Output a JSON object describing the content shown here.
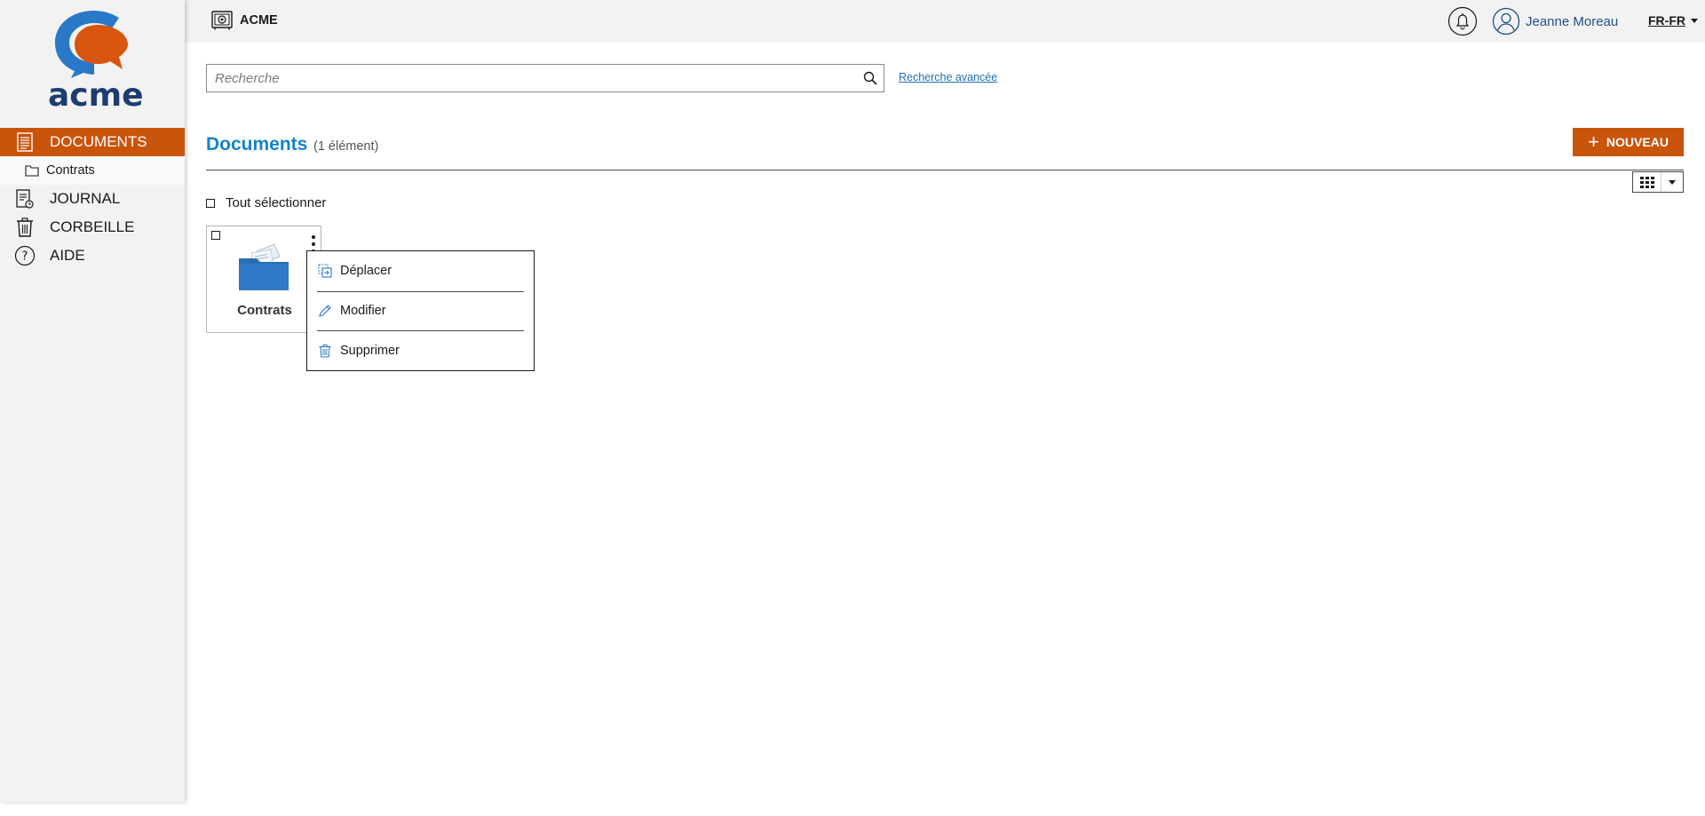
{
  "app": {
    "logo_text": "acme",
    "brand": "ACME"
  },
  "colors": {
    "accent": "#c9540c",
    "title_blue": "#1683c5",
    "logo_blue": "#2a78c8",
    "logo_orange": "#d9550e",
    "folder_blue": "#2a6db5"
  },
  "sidebar": {
    "items": [
      {
        "label": "DOCUMENTS",
        "icon": "document-list-icon",
        "active": true
      },
      {
        "label": "Contrats",
        "icon": "folder-icon",
        "sub": true
      },
      {
        "label": "JOURNAL",
        "icon": "journal-icon"
      },
      {
        "label": "CORBEILLE",
        "icon": "trash-icon"
      },
      {
        "label": "AIDE",
        "icon": "help-icon"
      }
    ]
  },
  "header": {
    "user_name": "Jeanne Moreau",
    "language": "FR-FR",
    "notifications_icon": "bell-icon",
    "user_icon": "user-icon"
  },
  "search": {
    "placeholder": "Recherche",
    "value": "",
    "advanced_link": "Recherche avancée"
  },
  "main": {
    "title": "Documents",
    "count": "(1 élément)",
    "new_button": "NOUVEAU",
    "select_all": "Tout sélectionner",
    "view_icon": "grid-view-icon",
    "items": [
      {
        "label": "Contrats",
        "type": "folder"
      }
    ]
  },
  "context_menu": {
    "items": [
      {
        "label": "Déplacer",
        "icon": "move-icon"
      },
      {
        "label": "Modifier",
        "icon": "pencil-icon"
      },
      {
        "label": "Supprimer",
        "icon": "trash-icon"
      }
    ]
  }
}
